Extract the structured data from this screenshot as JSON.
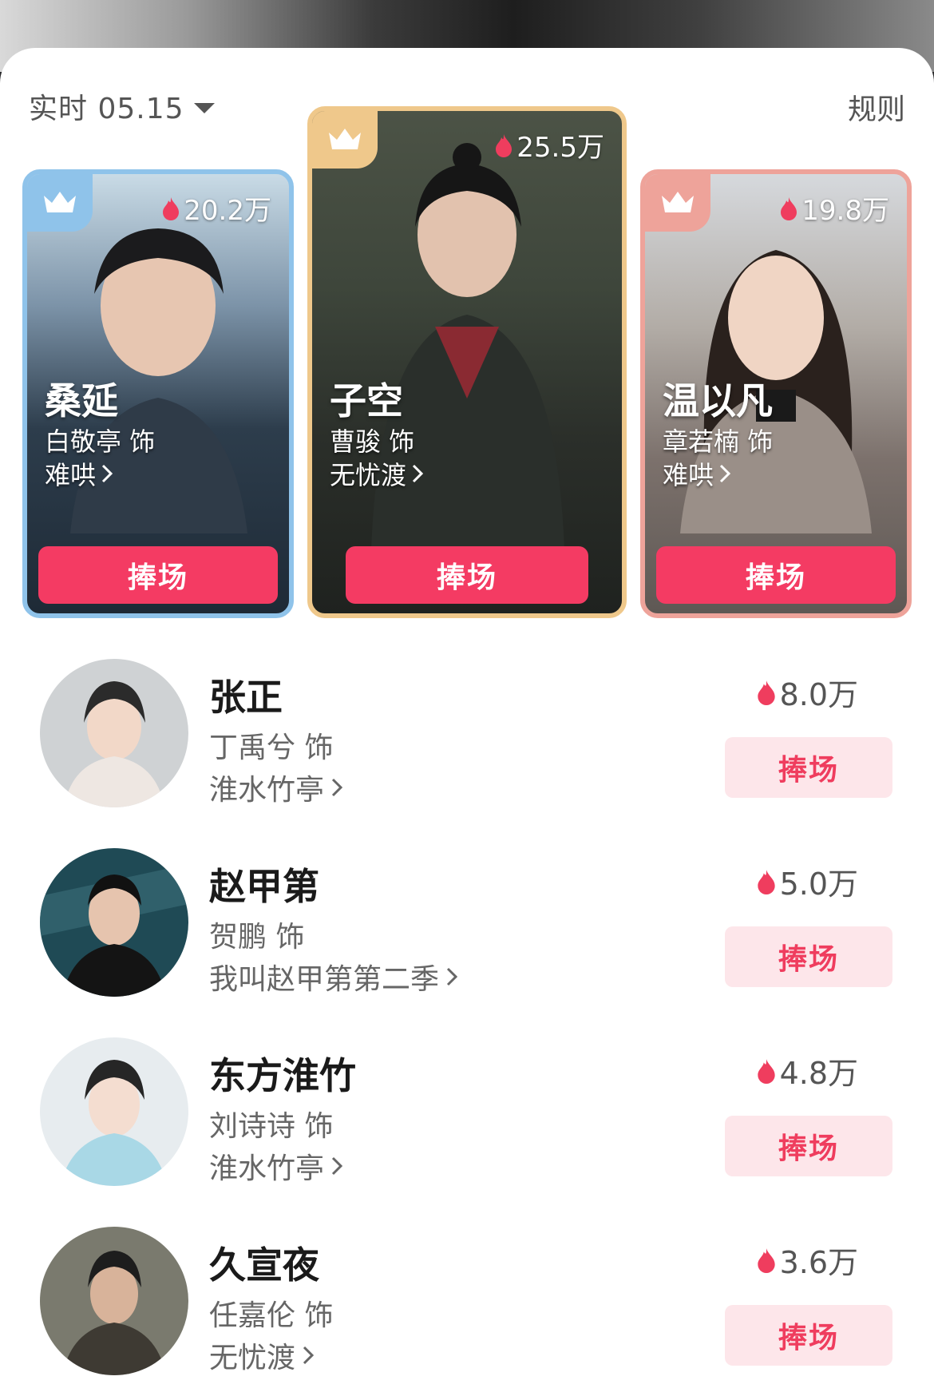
{
  "header": {
    "date_label": "实时 05.15",
    "rules_label": "规则"
  },
  "top3": [
    {
      "rank": 1,
      "heat": "25.5万",
      "name": "子空",
      "actor": "曹骏  饰",
      "drama": "无忧渡",
      "button": "捧场",
      "frame_color": "#efc88b"
    },
    {
      "rank": 2,
      "heat": "20.2万",
      "name": "桑延",
      "actor": "白敬亭  饰",
      "drama": "难哄",
      "button": "捧场",
      "frame_color": "#8fc3ea"
    },
    {
      "rank": 3,
      "heat": "19.8万",
      "name": "温以凡",
      "actor": "章若楠  饰",
      "drama": "难哄",
      "button": "捧场",
      "frame_color": "#eea39a"
    }
  ],
  "list": [
    {
      "name": "张正",
      "actor": "丁禹兮  饰",
      "drama": "淮水竹亭",
      "heat": "8.0万",
      "button": "捧场"
    },
    {
      "name": "赵甲第",
      "actor": "贺鹏  饰",
      "drama": "我叫赵甲第第二季",
      "heat": "5.0万",
      "button": "捧场"
    },
    {
      "name": "东方淮竹",
      "actor": "刘诗诗  饰",
      "drama": "淮水竹亭",
      "heat": "4.8万",
      "button": "捧场"
    },
    {
      "name": "久宣夜",
      "actor": "任嘉伦  饰",
      "drama": "无忧渡",
      "heat": "3.6万",
      "button": "捧场"
    }
  ],
  "colors": {
    "accent": "#f43b63",
    "button_light_bg": "#fde6ea",
    "button_light_text": "#ef3d5e",
    "flame": "#ef3d5e"
  },
  "icons": {
    "crown": "crown-icon",
    "flame": "flame-icon",
    "chevron": "chevron-right-icon",
    "caret": "caret-down-icon"
  }
}
